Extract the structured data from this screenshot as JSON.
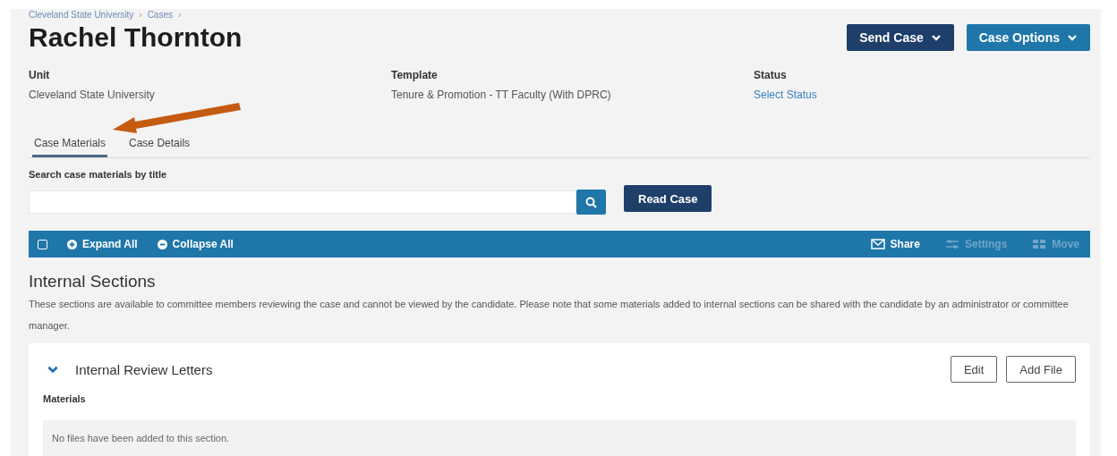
{
  "breadcrumb": [
    "Cleveland State University",
    "Cases"
  ],
  "breadcrumb_separator": "›",
  "title": "Rachel Thornton",
  "header_buttons": [
    {
      "label": "Send Case",
      "kind": "dark"
    },
    {
      "label": "Case Options",
      "kind": "light"
    }
  ],
  "meta": [
    {
      "label": "Unit",
      "value": "Cleveland State University",
      "kind": "text"
    },
    {
      "label": "Template",
      "value": "Tenure & Promotion - TT Faculty (With DPRC)",
      "kind": "text"
    },
    {
      "label": "Status",
      "value": "Select Status",
      "kind": "link"
    }
  ],
  "tabs": [
    {
      "label": "Case Materials",
      "selected": true
    },
    {
      "label": "Case Details",
      "selected": false
    }
  ],
  "search": {
    "label": "Search case materials by title"
  },
  "read_button": "Read Case",
  "toolbar": {
    "checked": false,
    "left": [
      {
        "label": "Expand All",
        "kind": "expand"
      },
      {
        "label": "Collapse All",
        "kind": "collapse"
      }
    ],
    "right": [
      {
        "label": "Share",
        "kind": "share",
        "disabled": false
      },
      {
        "label": "Settings",
        "kind": "settings",
        "disabled": true
      },
      {
        "label": "Move",
        "kind": "move",
        "disabled": true
      }
    ]
  },
  "section": {
    "heading": "Internal Sections",
    "description": "These sections are available to committee members reviewing the case and cannot be viewed by the candidate. Please note that some materials added to internal sections can be shared with the candidate by an administrator or committee manager.",
    "card": {
      "title": "Internal Review Letters",
      "expanded": true,
      "buttons": [
        "Edit",
        "Add File"
      ],
      "materials_label": "Materials",
      "empty": "No files have been added to this section."
    }
  }
}
